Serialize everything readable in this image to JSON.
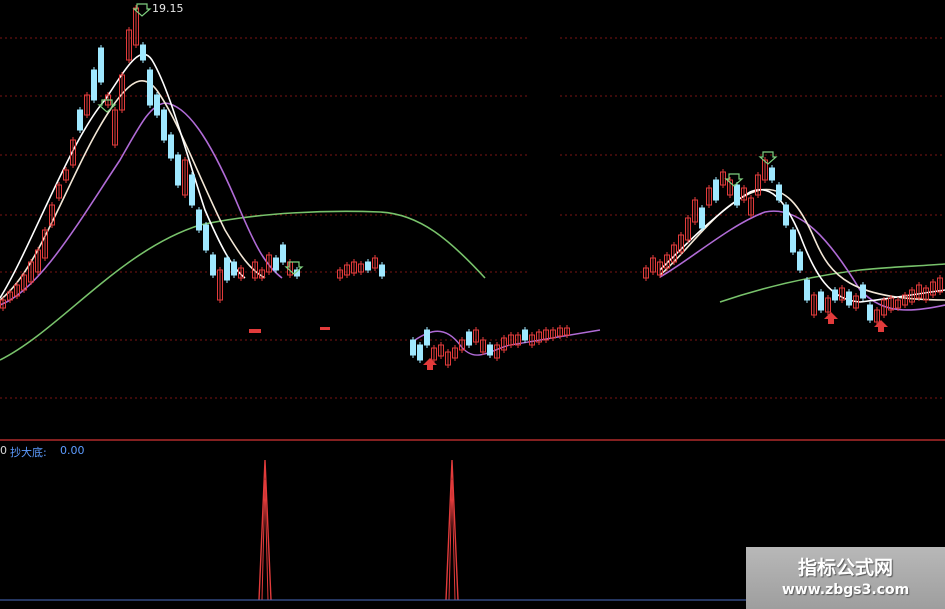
{
  "price_panel": {
    "high_label": "19.15"
  },
  "indicator_panel": {
    "prefix": "0",
    "name": "抄大底:",
    "value": "0.00"
  },
  "watermark": {
    "title": "指标公式网",
    "url": "www.zbgs3.com"
  },
  "colors": {
    "background": "#000000",
    "up_candle": "#e23b3b",
    "down_candle": "#9fe8ff",
    "ma_short": "#ffffff",
    "ma_mid": "#f3e7d6",
    "ma_long": "#b06bd6",
    "ma_very_long": "#78c26b",
    "grid": "#7a1414",
    "divider": "#b02a2a",
    "buy_arrow": "#e23b3b",
    "sell_arrow": "#7fd07f",
    "indicator_spike": "#e23b3b",
    "indicator_label": "#5d9cff"
  },
  "icons": {
    "sell_marker": "down-arrow-outline-icon",
    "buy_marker": "up-arrow-icon"
  },
  "indicator_spikes": [
    1,
    1
  ]
}
